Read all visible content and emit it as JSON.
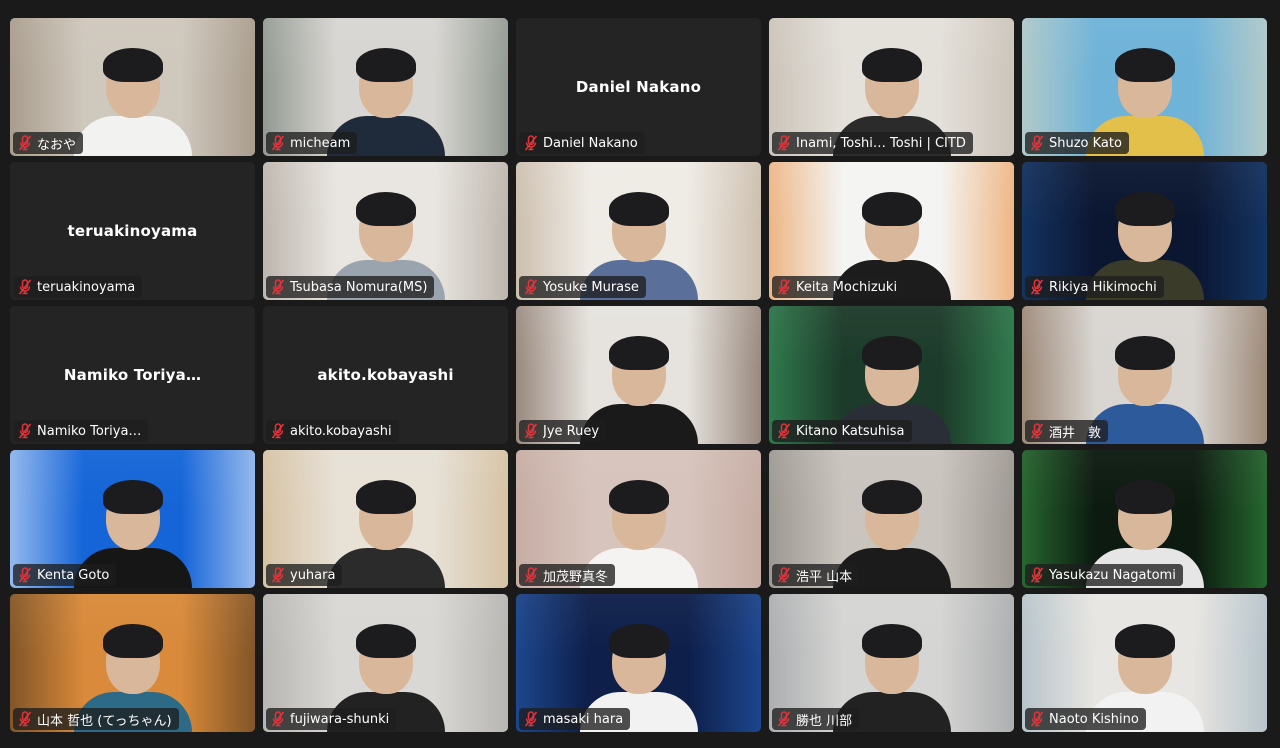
{
  "meeting": {
    "tiles": [
      {
        "name": "なおや",
        "video": true,
        "bg": "#cfc8bd",
        "accent": "#8a7a66",
        "shirt": "#f2f2f0"
      },
      {
        "name": "micheam",
        "video": true,
        "bg": "#d8d6d2",
        "accent": "#5b6a5e",
        "shirt": "#1f2a3a"
      },
      {
        "name": "Daniel Nakano",
        "video": false
      },
      {
        "name": "Inami, Toshi… Toshi | CITD",
        "video": true,
        "bg": "#e4e0da",
        "accent": "#b7ada0",
        "shirt": "#2b2b2b"
      },
      {
        "name": "Shuzo Kato",
        "video": true,
        "bg": "#6fb3d9",
        "accent": "#e8dcbc",
        "shirt": "#e3c04a"
      },
      {
        "name": "teruakinoyama",
        "video": false
      },
      {
        "name": "Tsubasa Nomura(MS)",
        "video": true,
        "bg": "#e9e6e1",
        "accent": "#9a8f84",
        "shirt": "#9aa4ae"
      },
      {
        "name": "Yosuke Murase",
        "video": true,
        "bg": "#efece6",
        "accent": "#b09a80",
        "shirt": "#5a6f9a"
      },
      {
        "name": "Keita Mochizuki",
        "video": true,
        "bg": "#f4f4f2",
        "accent": "#e9822a",
        "shirt": "#1c1c1c"
      },
      {
        "name": "Rikiya Hikimochi",
        "video": true,
        "bg": "#0b1631",
        "accent": "#1d4d8a",
        "shirt": "#3b3b2a"
      },
      {
        "name": "Namiko Toriya…",
        "video": false
      },
      {
        "name": "akito.kobayashi",
        "video": false
      },
      {
        "name": "Jye Ruey",
        "video": true,
        "bg": "#e6e3de",
        "accent": "#5a4030",
        "shirt": "#1a1a1a"
      },
      {
        "name": "Kitano Katsuhisa",
        "video": true,
        "bg": "#1d3b2a",
        "accent": "#3fae6a",
        "shirt": "#2a2e36"
      },
      {
        "name": "酒井　敦",
        "video": true,
        "bg": "#d9d6d2",
        "accent": "#6b4a2e",
        "shirt": "#2d5a9a"
      },
      {
        "name": "Kenta Goto",
        "video": true,
        "bg": "#1565d8",
        "accent": "#ffffff",
        "shirt": "#161616"
      },
      {
        "name": "yuhara",
        "video": true,
        "bg": "#e7e1d6",
        "accent": "#c9a97a",
        "shirt": "#2b2b2b"
      },
      {
        "name": "加茂野真冬",
        "video": true,
        "bg": "#d7c4bc",
        "accent": "#b89a90",
        "shirt": "#f5f3f1"
      },
      {
        "name": "浩平 山本",
        "video": true,
        "bg": "#c9c4bd",
        "accent": "#7a7570",
        "shirt": "#1b1b1b"
      },
      {
        "name": "Yasukazu Nagatomi",
        "video": true,
        "bg": "#0d1a10",
        "accent": "#3ca84a",
        "shirt": "#e6e6e6"
      },
      {
        "name": "山本 哲也 (てっちゃん)",
        "video": true,
        "bg": "#d98a3a",
        "accent": "#3a2a1a",
        "shirt": "#2c6a88"
      },
      {
        "name": "fujiwara-shunki",
        "video": true,
        "bg": "#dad8d4",
        "accent": "#9c9a96",
        "shirt": "#222222"
      },
      {
        "name": "masaki hara",
        "video": true,
        "bg": "#0e1f4a",
        "accent": "#2a68c7",
        "shirt": "#f2f2f2"
      },
      {
        "name": "勝也 川部",
        "video": true,
        "bg": "#d5d5d3",
        "accent": "#8b8f94",
        "shirt": "#222222"
      },
      {
        "name": "Naoto Kishino",
        "video": true,
        "bg": "#e8e6e2",
        "accent": "#8fa8b8",
        "shirt": "#f2f2f2"
      }
    ]
  },
  "colors": {
    "mic_muted": "#e3343c",
    "tile_off": "#242424",
    "app_bg": "#1a1a1a"
  },
  "icons": {
    "muted_mic": "microphone-muted-icon"
  }
}
